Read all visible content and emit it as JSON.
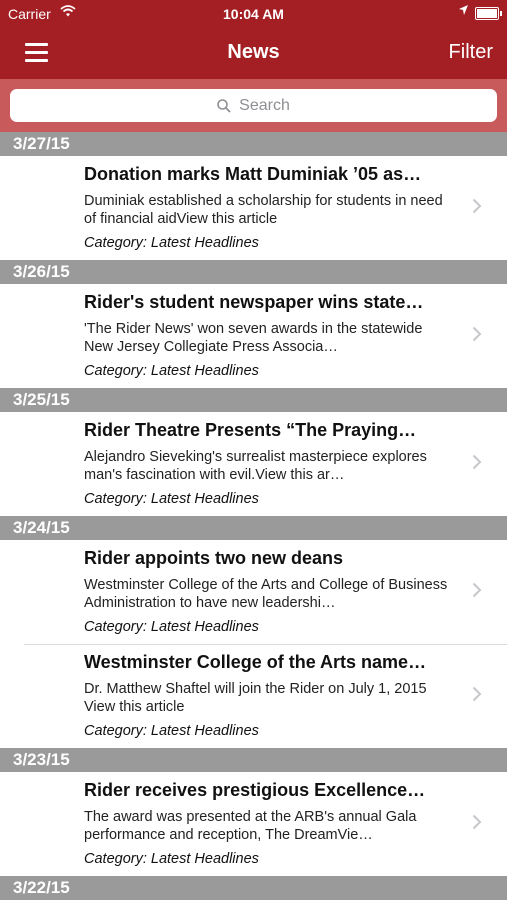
{
  "status_bar": {
    "carrier": "Carrier",
    "time": "10:04 AM"
  },
  "nav": {
    "title": "News",
    "filter_label": "Filter"
  },
  "search": {
    "placeholder": "Search"
  },
  "category_prefix": "Category:",
  "sections": [
    {
      "date": "3/27/15",
      "items": [
        {
          "title": "Donation marks Matt Duminiak ’05 as…",
          "description": "Duminiak established a scholarship for students in need of financial aidView this article",
          "category": "Category: Latest Headlines"
        }
      ]
    },
    {
      "date": "3/26/15",
      "items": [
        {
          "title": "Rider's student newspaper wins state…",
          "description": "'The Rider News' won seven awards in the statewide New Jersey Collegiate Press Associa…",
          "category": "Category: Latest Headlines"
        }
      ]
    },
    {
      "date": "3/25/15",
      "items": [
        {
          "title": "Rider Theatre Presents “The Praying…",
          "description": "Alejandro Sieveking's surrealist masterpiece explores man's fascination with evil.View this ar…",
          "category": "Category: Latest Headlines"
        }
      ]
    },
    {
      "date": "3/24/15",
      "items": [
        {
          "title": "Rider appoints two new deans",
          "description": "Westminster College of the Arts and College of Business Administration to have new leadershi…",
          "category": "Category: Latest Headlines"
        },
        {
          "title": "Westminster College of the Arts name…",
          "description": "Dr. Matthew Shaftel will join the Rider on July 1, 2015 View this article",
          "category": "Category: Latest Headlines"
        }
      ]
    },
    {
      "date": "3/23/15",
      "items": [
        {
          "title": "Rider receives prestigious Excellence…",
          "description": "The award was presented at the ARB's annual Gala performance and reception, The DreamVie…",
          "category": "Category: Latest Headlines"
        }
      ]
    },
    {
      "date": "3/22/15",
      "items": []
    }
  ],
  "colors": {
    "nav_bar": "#a41f24",
    "search_bar": "#c95a5c",
    "section_header": "#9a9a9a"
  },
  "icons": [
    "wifi-icon",
    "location-arrow-icon",
    "battery-icon",
    "menu-icon",
    "search-icon",
    "chevron-right-icon"
  ]
}
